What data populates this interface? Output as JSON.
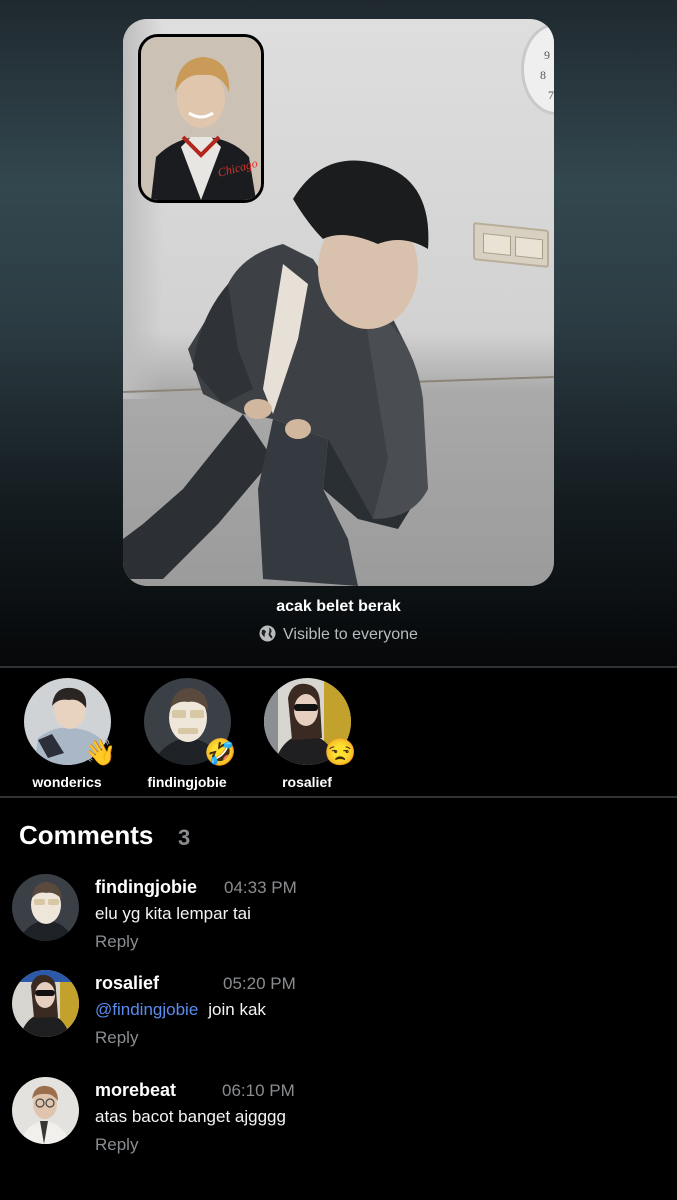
{
  "post": {
    "caption": "acak belet berak",
    "visibility": "Visible to everyone",
    "clock_numbers": [
      "9",
      "8",
      "7"
    ],
    "pip_jacket_text": "Chicago"
  },
  "reactions": [
    {
      "username": "wonderics",
      "emoji": "👋"
    },
    {
      "username": "findingjobie",
      "emoji": "🤣"
    },
    {
      "username": "rosalief",
      "emoji": "😒"
    }
  ],
  "comments_section": {
    "title": "Comments",
    "count": "3"
  },
  "comments": [
    {
      "username": "findingjobie",
      "time": "04:33 PM",
      "mention": "",
      "text": "elu yg kita lempar tai",
      "reply_label": "Reply"
    },
    {
      "username": "rosalief",
      "time": "05:20 PM",
      "mention": "@findingjobie",
      "text": "join kak",
      "reply_label": "Reply"
    },
    {
      "username": "morebeat",
      "time": "06:10 PM",
      "mention": "",
      "text": "atas bacot banget ajgggg",
      "reply_label": "Reply"
    }
  ],
  "colors": {
    "background": "#000000",
    "muted_text": "#8a8d90",
    "mention": "#5b8cf0"
  }
}
